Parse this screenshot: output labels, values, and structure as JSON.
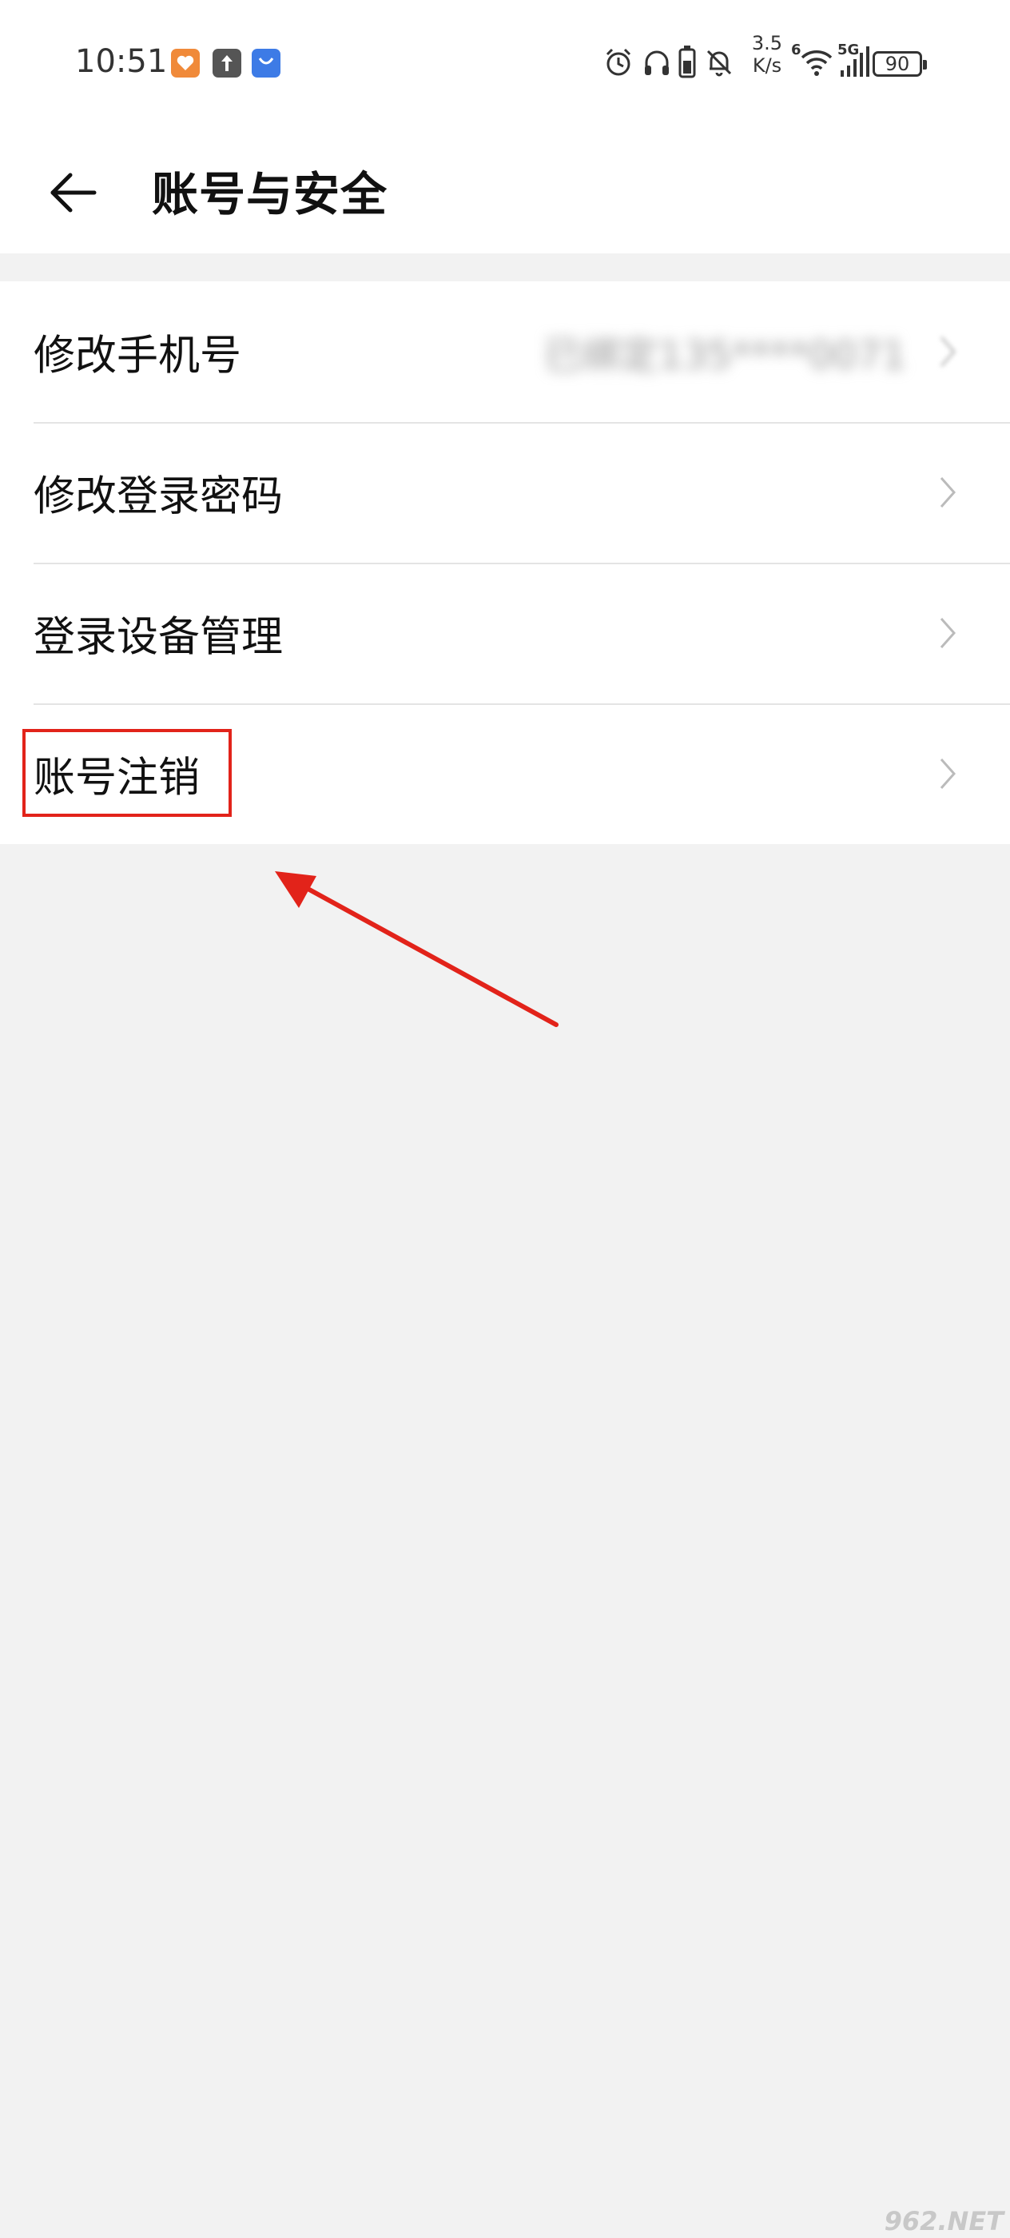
{
  "status_bar": {
    "time": "10:51",
    "net_speed_value": "3.5",
    "net_speed_unit": "K/s",
    "wifi_badge": "6",
    "cell_badge": "5G",
    "battery": "90",
    "app_icons": [
      "health-app-icon",
      "upload-icon",
      "app-store-icon"
    ],
    "icons": [
      "alarm-icon",
      "headphones-icon",
      "battery-saver-icon",
      "bell-muted-icon",
      "wifi-icon",
      "signal-icon"
    ]
  },
  "header": {
    "title": "账号与安全",
    "back_icon": "back-arrow-icon"
  },
  "list": {
    "items": [
      {
        "label": "修改手机号",
        "value": "已绑定135****0071"
      },
      {
        "label": "修改登录密码"
      },
      {
        "label": "登录设备管理"
      },
      {
        "label": "账号注销"
      }
    ]
  },
  "annotation": {
    "highlight_color": "#e2231a"
  },
  "watermark": "962.NET"
}
